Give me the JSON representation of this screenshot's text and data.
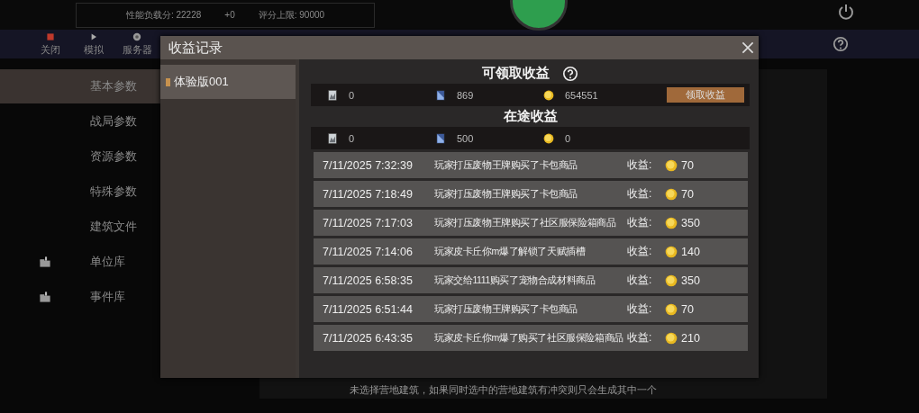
{
  "top_bar": {
    "score": "性能负载分: 22228",
    "delta": "+0",
    "limit": "评分上限: 90000"
  },
  "toolbar": [
    {
      "label": "关闭",
      "kind": "stop"
    },
    {
      "label": "模拟",
      "kind": "play"
    },
    {
      "label": "服务器",
      "kind": "server"
    }
  ],
  "sidebar": {
    "items": [
      {
        "label": "基本参数",
        "selected": true,
        "kind": "text"
      },
      {
        "label": "战局参数",
        "selected": false,
        "kind": "text"
      },
      {
        "label": "资源参数",
        "selected": false,
        "kind": "text"
      },
      {
        "label": "特殊参数",
        "selected": false,
        "kind": "text"
      },
      {
        "label": "建筑文件",
        "selected": false,
        "kind": "text"
      },
      {
        "label": "单位库",
        "selected": false,
        "kind": "folder"
      },
      {
        "label": "事件库",
        "selected": false,
        "kind": "folder"
      }
    ]
  },
  "hint": "未选择营地建筑，如果同时选中的营地建筑有冲突则只会生成其中一个",
  "dialog": {
    "title": "收益记录",
    "versions": [
      {
        "label": "体验版001",
        "selected": true
      }
    ],
    "claimable": {
      "title": "可领取收益",
      "card_a": "0",
      "card_b": "869",
      "coins": "654551",
      "button": "领取收益"
    },
    "in_transit": {
      "title": "在途收益",
      "card_a": "0",
      "card_b": "500",
      "coins": "0"
    },
    "records": [
      {
        "time": "7/11/2025 7:32:39",
        "text": "玩家打压废物王牌购买了卡包商品",
        "label": "收益:",
        "amount": "70"
      },
      {
        "time": "7/11/2025 7:18:49",
        "text": "玩家打压废物王牌购买了卡包商品",
        "label": "收益:",
        "amount": "70"
      },
      {
        "time": "7/11/2025 7:17:03",
        "text": "玩家打压废物王牌购买了社区服保险箱商品",
        "label": "收益:",
        "amount": "350"
      },
      {
        "time": "7/11/2025 7:14:06",
        "text": "玩家皮卡丘你m爆了解锁了天赋插槽",
        "label": "收益:",
        "amount": "140"
      },
      {
        "time": "7/11/2025 6:58:35",
        "text": "玩家交给1111购买了宠物合成材料商品",
        "label": "收益:",
        "amount": "350"
      },
      {
        "time": "7/11/2025 6:51:44",
        "text": "玩家打压废物王牌购买了卡包商品",
        "label": "收益:",
        "amount": "70"
      },
      {
        "time": "7/11/2025 6:43:35",
        "text": "玩家皮卡丘你m爆了购买了社区服保险箱商品",
        "label": "收益:",
        "amount": "210"
      }
    ]
  }
}
